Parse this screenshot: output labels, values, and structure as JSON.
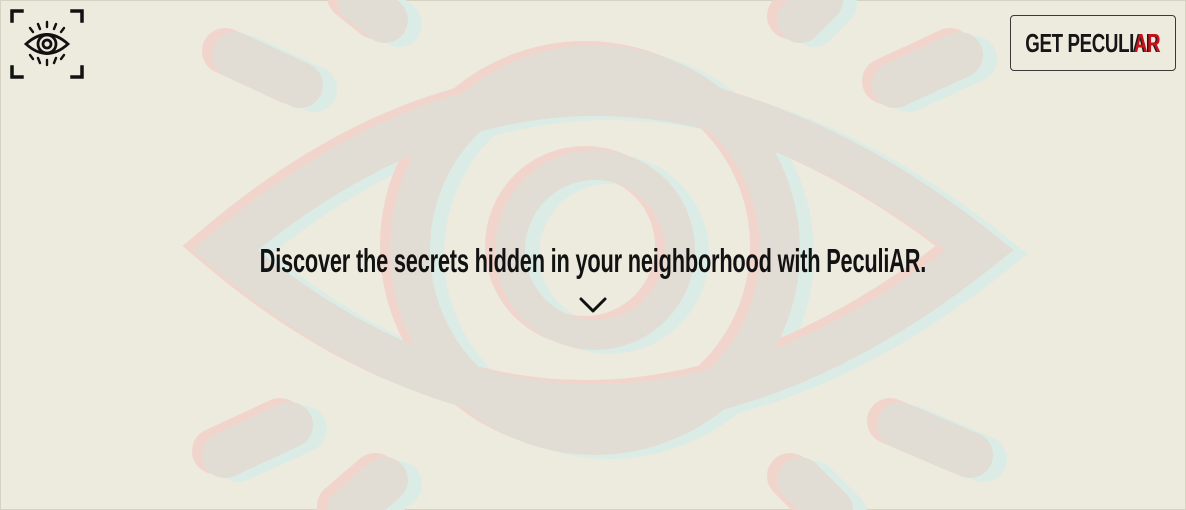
{
  "header": {
    "logo_icon": "eye-icon",
    "cta_label_main": "GET PECULI",
    "cta_label_accent": "AR"
  },
  "hero": {
    "headline": "Discover the secrets hidden in your neighborhood with PeculiAR.",
    "scroll_icon": "chevron-down-icon",
    "background_icon": "eye-icon"
  },
  "colors": {
    "background": "#edeade",
    "text": "#121212",
    "accent": "#c6121c",
    "eye_watermark": "#e2ddd4",
    "eye_shadow_red": "#f1d5cc",
    "eye_shadow_cyan": "#dbece6"
  }
}
